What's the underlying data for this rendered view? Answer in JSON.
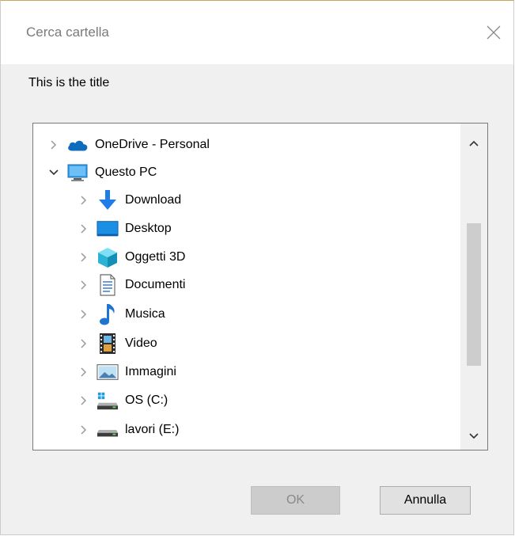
{
  "window": {
    "title": "Cerca cartella",
    "description": "This is the title"
  },
  "tree": {
    "items": [
      {
        "label": "OneDrive - Personal",
        "icon": "onedrive-cloud-icon",
        "expanded": false,
        "level": 0
      },
      {
        "label": "Questo PC",
        "icon": "this-pc-icon",
        "expanded": true,
        "level": 0
      },
      {
        "label": "Download",
        "icon": "download-arrow-icon",
        "expanded": false,
        "level": 1
      },
      {
        "label": "Desktop",
        "icon": "desktop-icon",
        "expanded": false,
        "level": 1
      },
      {
        "label": "Oggetti 3D",
        "icon": "3d-objects-icon",
        "expanded": false,
        "level": 1
      },
      {
        "label": "Documenti",
        "icon": "documents-icon",
        "expanded": false,
        "level": 1
      },
      {
        "label": "Musica",
        "icon": "music-note-icon",
        "expanded": false,
        "level": 1
      },
      {
        "label": "Video",
        "icon": "video-film-icon",
        "expanded": false,
        "level": 1
      },
      {
        "label": "Immagini",
        "icon": "pictures-icon",
        "expanded": false,
        "level": 1
      },
      {
        "label": "OS (C:)",
        "icon": "system-drive-icon",
        "expanded": false,
        "level": 1
      },
      {
        "label": "lavori (E:)",
        "icon": "drive-icon",
        "expanded": false,
        "level": 1
      }
    ]
  },
  "buttons": {
    "ok": "OK",
    "cancel": "Annulla"
  },
  "colors": {
    "onedrive": "#0f6cbd",
    "download": "#1e7de6",
    "desktop": "#1a8fe3",
    "objects3d": "#2bb3d6",
    "music": "#1e74d0",
    "disabled_button": "#cccccc"
  }
}
